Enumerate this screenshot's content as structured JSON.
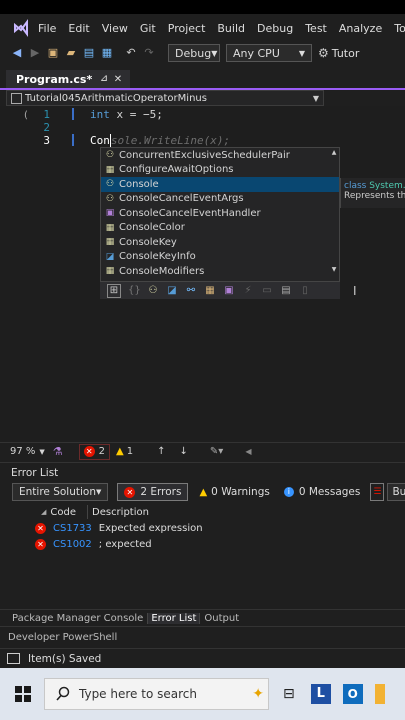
{
  "menu": {
    "items": [
      "File",
      "Edit",
      "View",
      "Git",
      "Project",
      "Build",
      "Debug",
      "Test",
      "Analyze",
      "Tools"
    ]
  },
  "toolbar": {
    "config": "Debug",
    "platform": "Any CPU",
    "run_label": "Tutor"
  },
  "doc_tab": {
    "title": "Program.cs*",
    "close": "✕"
  },
  "navbar": {
    "project": "Tutorial045ArithmaticOperatorMinus"
  },
  "editor": {
    "line_numbers": [
      "1",
      "2",
      "3"
    ],
    "line1": {
      "kw": "int",
      "rest": " x = −5;"
    },
    "line3": {
      "typed": "Con",
      "ghost": "sole.WriteLine(x);"
    }
  },
  "autocomplete": {
    "items": [
      {
        "label": "ConcurrentExclusiveSchedulerPair",
        "icon": "class-icon"
      },
      {
        "label": "ConfigureAwaitOptions",
        "icon": "enum-icon"
      },
      {
        "label": "Console",
        "icon": "class-icon",
        "selected": true
      },
      {
        "label": "ConsoleCancelEventArgs",
        "icon": "class-icon"
      },
      {
        "label": "ConsoleCancelEventHandler",
        "icon": "delegate-icon"
      },
      {
        "label": "ConsoleColor",
        "icon": "enum-icon"
      },
      {
        "label": "ConsoleKey",
        "icon": "enum-icon"
      },
      {
        "label": "ConsoleKeyInfo",
        "icon": "struct-icon"
      },
      {
        "label": "ConsoleModifiers",
        "icon": "enum-icon"
      }
    ],
    "tooltip_line1_kw": "class",
    "tooltip_line1_rest": " System.Co",
    "tooltip_line2": "Represents the"
  },
  "status_bar": {
    "zoom": "97 %",
    "errors": "2",
    "warnings": "1"
  },
  "error_list": {
    "title": "Error List",
    "scope": "Entire Solution",
    "errors_btn": "2 Errors",
    "warnings_btn": "0 Warnings",
    "messages_btn": "0 Messages",
    "build_btn": "Buil",
    "col_code": "Code",
    "col_desc": "Description",
    "rows": [
      {
        "code": "CS1733",
        "desc": "Expected expression"
      },
      {
        "code": "CS1002",
        "desc": "; expected"
      }
    ]
  },
  "bottom_tabs": [
    "Package Manager Console",
    "Error List",
    "Output"
  ],
  "dev_ps": "Developer PowerShell",
  "saved": "Item(s) Saved",
  "taskbar": {
    "search_placeholder": "Type here to search"
  },
  "colors": {
    "accent": "#9a5cf5",
    "selection": "#094771",
    "error": "#e51400",
    "keyword": "#569cd6",
    "line_number": "#2b91af"
  }
}
